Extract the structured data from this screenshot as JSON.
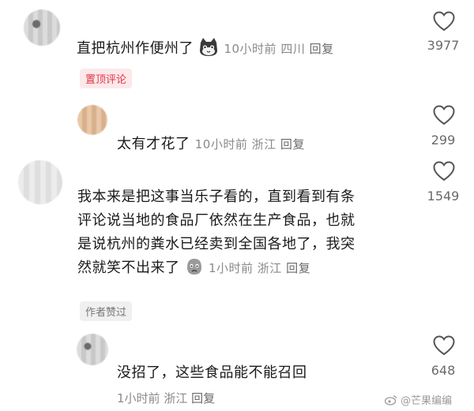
{
  "comments": [
    {
      "text": "直把杭州作便州了",
      "time": "10小时前",
      "location": "四川",
      "reply": "回复",
      "likes": "3977",
      "tag": "置顶评论",
      "emoji": "cat-face-icon"
    },
    {
      "text": "太有才花了",
      "time": "10小时前",
      "location": "浙江",
      "reply": "回复",
      "likes": "299"
    },
    {
      "lines": [
        "我本来是把这事当乐子看的，直到看到有条",
        "评论说当地的食品厂依然在生产食品，也就",
        "是说杭州的粪水已经卖到全国各地了，我突",
        "然就笑不出来了"
      ],
      "time": "1小时前",
      "location": "浙江",
      "reply": "回复",
      "likes": "1549",
      "tag": "作者赞过",
      "emoji": "sad-face-icon"
    },
    {
      "text": "没招了，这些食品能不能召回",
      "time": "1小时前",
      "location": "浙江",
      "reply": "回复",
      "likes": "648"
    }
  ],
  "watermark": "@芒果编编",
  "colors": {
    "pinned": "#e0364a",
    "meta": "#8a8a8a"
  }
}
